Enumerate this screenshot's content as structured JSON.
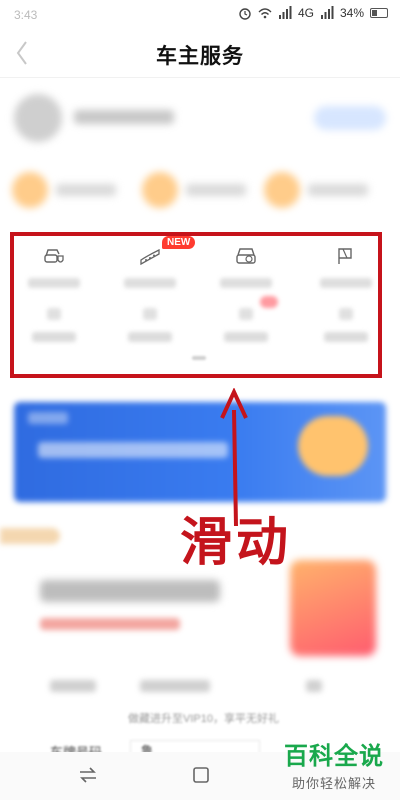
{
  "status_bar": {
    "time": "3:43",
    "network": "4G",
    "battery": "34%"
  },
  "header": {
    "title": "车主服务"
  },
  "services": {
    "new_badge": "NEW",
    "icons": [
      "car-shield-icon",
      "car-parts-icon",
      "car-wash-icon",
      "road-flag-icon"
    ]
  },
  "annotation": {
    "swipe_label": "滑动",
    "highlight_color": "#c6131b"
  },
  "promo": {
    "vip_text": "做藏进升至VIP10，享平无好礼"
  },
  "plate": {
    "label": "车牌号码",
    "value": "鲁"
  },
  "watermark": {
    "title": "百科全说",
    "subtitle": "助你轻松解决"
  },
  "colors": {
    "accent_red": "#c6131b",
    "banner_blue": "#2f6be0",
    "watermark_green": "#19a84c"
  }
}
